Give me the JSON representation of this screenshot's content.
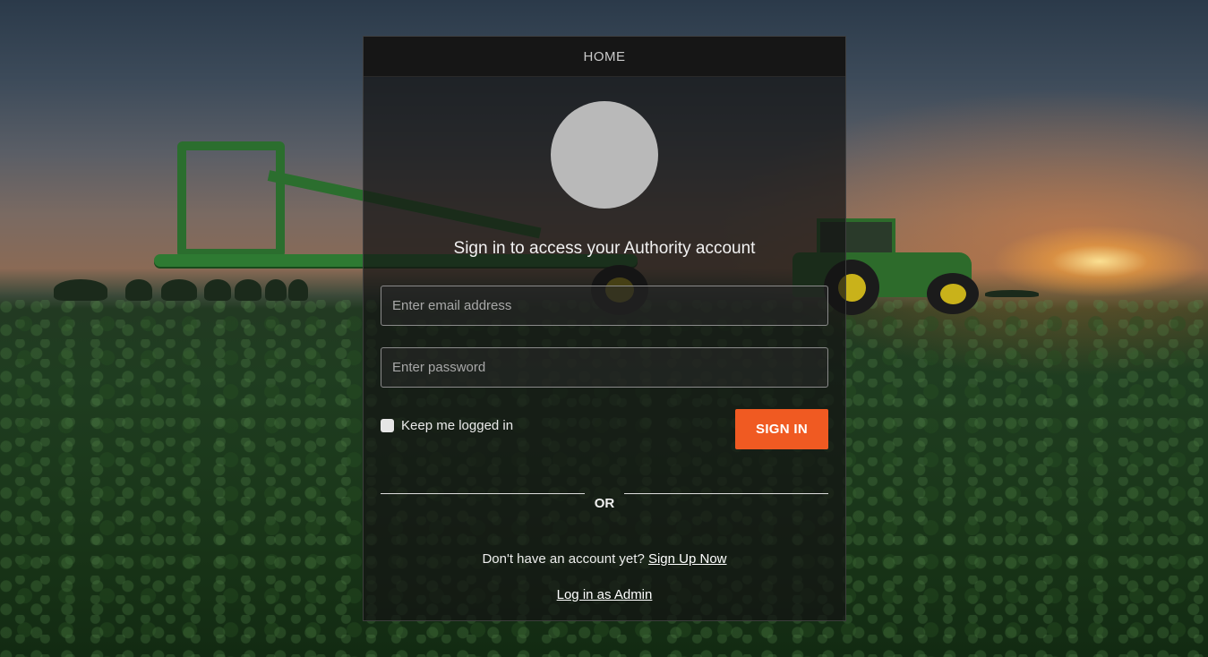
{
  "header": {
    "home_label": "HOME"
  },
  "login": {
    "heading": "Sign in to access your Authority account",
    "email_placeholder": "Enter email address",
    "password_placeholder": "Enter password",
    "remember_label": "Keep me logged in",
    "remember_checked": false,
    "signin_label": "SIGN IN",
    "divider_text": "OR",
    "signup_prompt": "Don't have an account yet?",
    "signup_link": "Sign Up Now",
    "admin_link": "Log in as Admin"
  },
  "colors": {
    "accent": "#f05a22",
    "panel": "rgba(20,20,20,0.72)",
    "avatar": "#b9b9b9"
  },
  "icons": {
    "avatar": "avatar-placeholder"
  }
}
